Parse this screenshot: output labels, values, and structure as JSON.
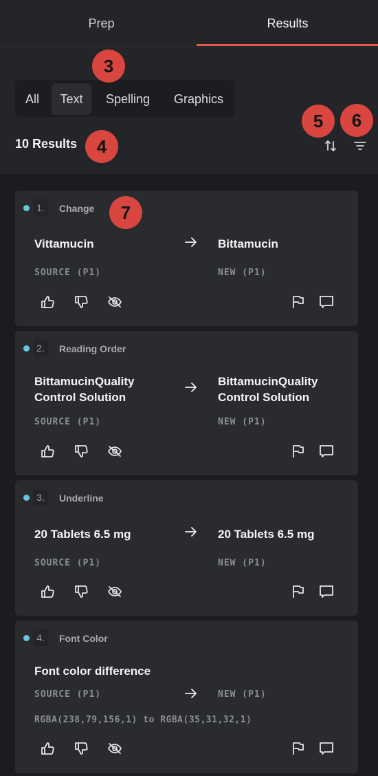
{
  "tabs": {
    "prep": "Prep",
    "results": "Results"
  },
  "filters": [
    "All",
    "Text",
    "Spelling",
    "Graphics"
  ],
  "active_filter": "Text",
  "result_count": "10 Results",
  "badges": {
    "b3": "3",
    "b4": "4",
    "b5": "5",
    "b6": "6",
    "b7": "7"
  },
  "accent_color": "#e8584d",
  "badge_color": "#d9463f",
  "dot_color": "#69c7dc",
  "toolbar_icons": [
    "sort-icon",
    "filter-icon"
  ],
  "action_icons": [
    "thumbs-up-icon",
    "thumbs-down-icon",
    "hide-icon",
    "flag-icon",
    "comment-icon"
  ],
  "results": [
    {
      "num": "1.",
      "type": "Change",
      "source": "Vittamucin",
      "new": "Bittamucin",
      "source_label": "SOURCE (P1)",
      "new_label": "NEW (P1)"
    },
    {
      "num": "2.",
      "type": "Reading Order",
      "source": "BittamucinQuality Control Solution",
      "new": "BittamucinQuality Control Solution",
      "source_label": "SOURCE (P1)",
      "new_label": "NEW (P1)"
    },
    {
      "num": "3.",
      "type": "Underline",
      "source": "20 Tablets 6.5 mg",
      "new": "20 Tablets 6.5 mg",
      "source_label": "SOURCE (P1)",
      "new_label": "NEW (P1)"
    },
    {
      "num": "4.",
      "type": "Font Color",
      "title": "Font color difference",
      "source_label": "SOURCE (P1)",
      "new_label": "NEW (P1)",
      "detail": "RGBA(238,79,156,1) to RGBA(35,31,32,1)"
    }
  ]
}
